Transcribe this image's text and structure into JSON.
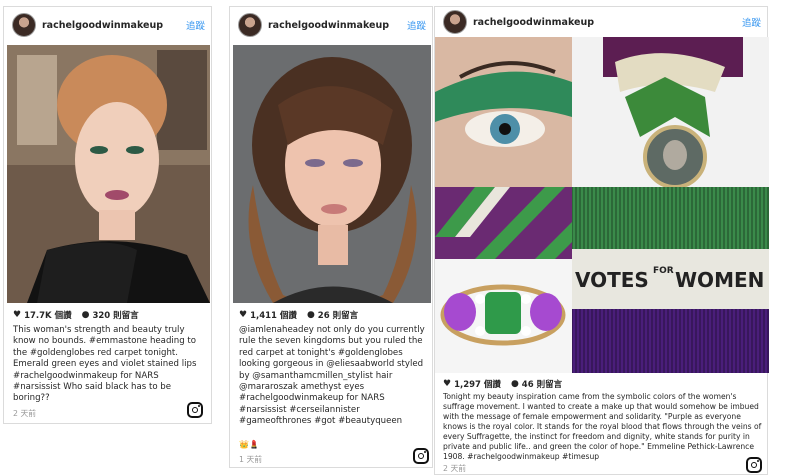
{
  "posts": [
    {
      "username": "rachelgoodwinmakeup",
      "follow": "追蹤",
      "likes": "17.7K 個讚",
      "comments": "320 則留言",
      "caption": "This woman's strength and beauty truly know no bounds. #emmastone heading to the #goldenglobes red carpet tonight. Emerald green eyes and violet stained lips #rachelgoodwinmakeup for NARS #narsissist Who said black has to be boring??",
      "time": "2 天前"
    },
    {
      "username": "rachelgoodwinmakeup",
      "follow": "追蹤",
      "likes": "1,411 個讚",
      "comments": "26 則留言",
      "caption": "@iamlenaheadey not only do you currently rule the seven kingdoms but you ruled the red carpet at tonight's #goldenglobes looking gorgeous in @eliesaabworld styled by @samanthamcmillen_stylist hair @mararoszak amethyst eyes #rachelgoodwinmakeup for NARS #narsissist #cerseilannister #gameofthrones #got #beautyqueen",
      "emoji": "👑💄",
      "time": "1 天前"
    },
    {
      "username": "rachelgoodwinmakeup",
      "follow": "追蹤",
      "likes": "1,297 個讚",
      "comments": "46 則留言",
      "caption": "Tonight my beauty inspiration came from the symbolic colors of the women's suffrage movement. I wanted to create a make up that would somehow be imbued with the message of female empowerment and solidarity. \"Purple as everyone knows is the royal color. It stands for the royal blood that flows through the veins of every Suffragette, the instinct for freedom and dignity, white stands for purity in private and public life.. and green the color of hope.\" Emmeline Pethick-Lawrence 1908. #rachelgoodwinmakeup #timesup",
      "banner": "VOTES FOR WOMEN",
      "banner_left": "VOTES",
      "banner_for": "FOR",
      "banner_right": "WOMEN",
      "time": "2 天前"
    }
  ],
  "icons": {
    "heart": "heart-icon",
    "comment": "comment-icon",
    "instagram": "instagram-logo-icon"
  },
  "colors": {
    "link": "#003569",
    "follow": "#3897f0",
    "green": "#2e8b57",
    "purple": "#5b2a86"
  }
}
